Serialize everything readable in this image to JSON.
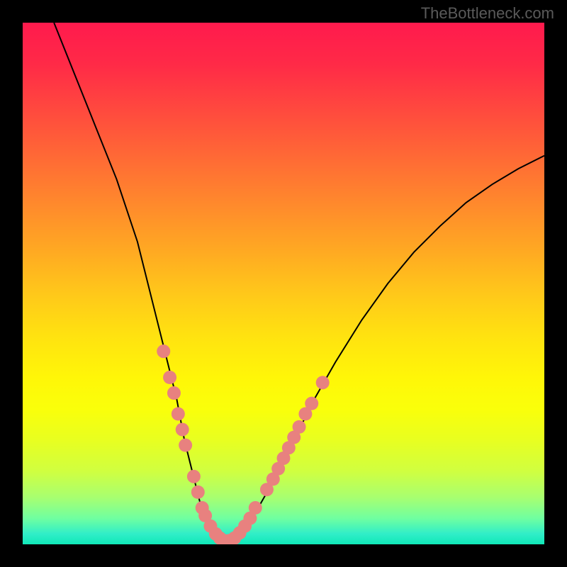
{
  "watermark": "TheBottleneck.com",
  "colors": {
    "background": "#000000",
    "watermark_text": "#5a5a5a",
    "curve_stroke": "#000000",
    "dot_fill": "#e8817f",
    "gradient_top": "#ff1a4d",
    "gradient_bottom": "#10e8b8"
  },
  "chart_data": {
    "type": "line",
    "title": "",
    "xlabel": "",
    "ylabel": "",
    "xlim": [
      0,
      100
    ],
    "ylim": [
      0,
      100
    ],
    "series": [
      {
        "name": "bottleneck-curve",
        "x": [
          6,
          10,
          14,
          18,
          22,
          25,
          27.5,
          29.5,
          31,
          32.5,
          34,
          35.5,
          37,
          38.5,
          40,
          42,
          44,
          48,
          52,
          56,
          60,
          65,
          70,
          75,
          80,
          85,
          90,
          95,
          100
        ],
        "y": [
          100,
          90,
          80,
          70,
          58,
          46,
          36,
          28,
          20,
          14,
          8,
          4,
          1.5,
          0.5,
          1,
          2.5,
          5,
          12,
          20,
          28,
          35,
          43,
          50,
          56,
          61,
          65.5,
          69,
          72,
          74.5
        ]
      }
    ],
    "scatter_overlay": {
      "name": "highlighted-points",
      "points": [
        {
          "x": 27.0,
          "y": 37
        },
        {
          "x": 28.2,
          "y": 32
        },
        {
          "x": 29.0,
          "y": 29
        },
        {
          "x": 29.8,
          "y": 25
        },
        {
          "x": 30.6,
          "y": 22
        },
        {
          "x": 31.2,
          "y": 19
        },
        {
          "x": 32.8,
          "y": 13
        },
        {
          "x": 33.6,
          "y": 10
        },
        {
          "x": 34.4,
          "y": 7
        },
        {
          "x": 35.0,
          "y": 5.5
        },
        {
          "x": 36.0,
          "y": 3.5
        },
        {
          "x": 37.0,
          "y": 2
        },
        {
          "x": 37.8,
          "y": 1.2
        },
        {
          "x": 38.6,
          "y": 0.7
        },
        {
          "x": 39.6,
          "y": 0.7
        },
        {
          "x": 40.6,
          "y": 1.2
        },
        {
          "x": 41.6,
          "y": 2.2
        },
        {
          "x": 42.6,
          "y": 3.5
        },
        {
          "x": 43.6,
          "y": 5
        },
        {
          "x": 44.6,
          "y": 7
        },
        {
          "x": 46.8,
          "y": 10.5
        },
        {
          "x": 48.0,
          "y": 12.5
        },
        {
          "x": 49.0,
          "y": 14.5
        },
        {
          "x": 50.0,
          "y": 16.5
        },
        {
          "x": 51.0,
          "y": 18.5
        },
        {
          "x": 52.0,
          "y": 20.5
        },
        {
          "x": 53.0,
          "y": 22.5
        },
        {
          "x": 54.2,
          "y": 25
        },
        {
          "x": 55.4,
          "y": 27
        },
        {
          "x": 57.5,
          "y": 31
        }
      ]
    }
  }
}
